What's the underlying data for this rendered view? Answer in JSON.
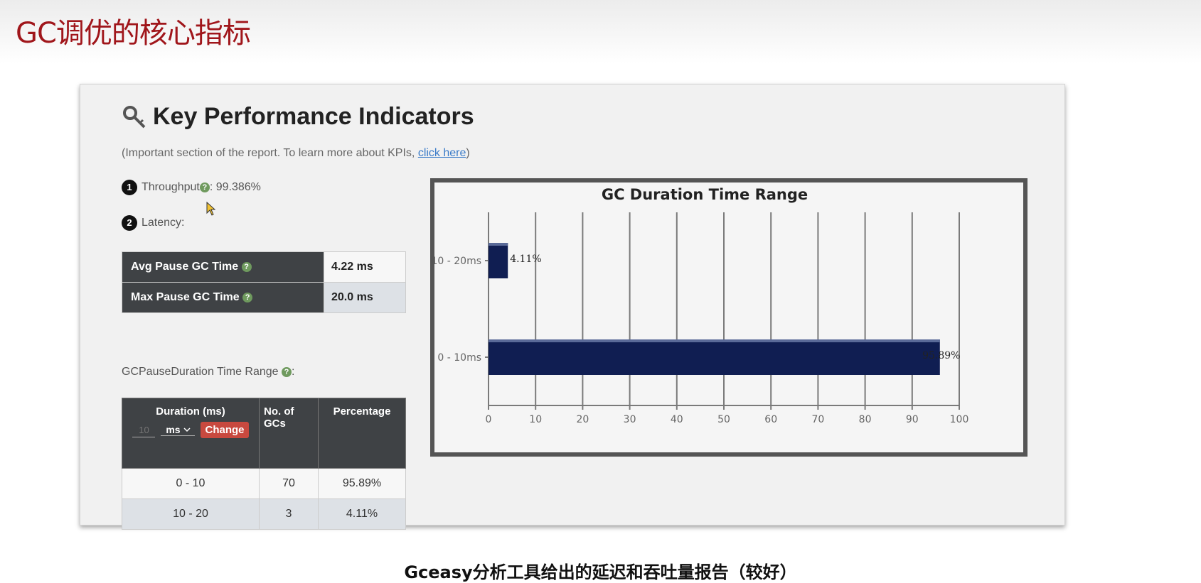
{
  "slide": {
    "title": "GC调优的核心指标",
    "caption": "Gceasy分析工具给出的延迟和吞吐量报告（较好）"
  },
  "kpi": {
    "title": "Key Performance Indicators",
    "subtitle_prefix": "(Important section of the report. To learn more about KPIs, ",
    "subtitle_link": "click here",
    "subtitle_suffix": ")",
    "throughput": {
      "badge": "1",
      "label": "Throughput",
      "value": ": 99.386%"
    },
    "latency": {
      "badge": "2",
      "label": "Latency:"
    },
    "help_glyph": "?",
    "pause_rows": [
      {
        "label": "Avg Pause GC Time",
        "value": "4.22 ms"
      },
      {
        "label": "Max Pause GC Time",
        "value": "20.0 ms"
      }
    ]
  },
  "range_section": {
    "label": "GCPauseDuration Time Range",
    "label_suffix": ":",
    "headers": {
      "duration": "Duration (ms)",
      "count": "No. of GCs",
      "percentage": "Percentage"
    },
    "input_placeholder": "10",
    "unit_selected": "ms",
    "change_button": "Change",
    "rows": [
      {
        "range": "0 - 10",
        "count": "70",
        "pct": "95.89%"
      },
      {
        "range": "10 - 20",
        "count": "3",
        "pct": "4.11%"
      }
    ]
  },
  "chart_data": {
    "type": "bar",
    "orientation": "horizontal",
    "title": "GC Duration Time Range",
    "categories": [
      "10 - 20ms",
      "0 - 10ms"
    ],
    "values": [
      4.11,
      95.89
    ],
    "data_labels": [
      "4.11%",
      "95.89%"
    ],
    "xlim": [
      0,
      100
    ],
    "xticks": [
      0,
      10,
      20,
      30,
      40,
      50,
      60,
      70,
      80,
      90,
      100
    ],
    "grid": true,
    "bar_color": "#101e52"
  }
}
